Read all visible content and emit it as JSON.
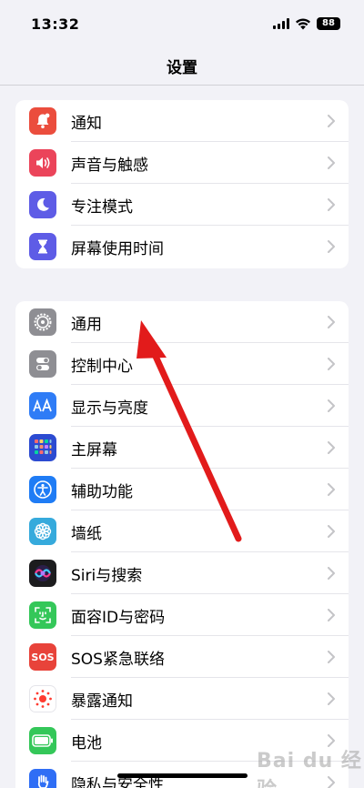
{
  "status_bar": {
    "time": "13:32",
    "battery": "88"
  },
  "nav": {
    "title": "设置"
  },
  "group1": [
    {
      "label": "通知",
      "icon": "bell-icon",
      "color": "#eb4d3d"
    },
    {
      "label": "声音与触感",
      "icon": "speaker-icon",
      "color": "#eb445a"
    },
    {
      "label": "专注模式",
      "icon": "moon-icon",
      "color": "#5e5ce6"
    },
    {
      "label": "屏幕使用时间",
      "icon": "hourglass-icon",
      "color": "#5e5ce6"
    }
  ],
  "group2": [
    {
      "label": "通用",
      "icon": "gear-icon",
      "color": "#8e8e93"
    },
    {
      "label": "控制中心",
      "icon": "toggles-icon",
      "color": "#8e8e93"
    },
    {
      "label": "显示与亮度",
      "icon": "text-size-icon",
      "color": "#2f7cf6"
    },
    {
      "label": "主屏幕",
      "icon": "home-grid-icon",
      "color": "#2c4bd1"
    },
    {
      "label": "辅助功能",
      "icon": "accessibility-icon",
      "color": "#1f7cf5"
    },
    {
      "label": "墙纸",
      "icon": "flower-icon",
      "color": "#36aadc"
    },
    {
      "label": "Siri与搜索",
      "icon": "siri-icon",
      "color": "#1c1c1e"
    },
    {
      "label": "面容ID与密码",
      "icon": "faceid-icon",
      "color": "#34c759"
    },
    {
      "label": "SOS紧急联络",
      "icon": "sos-icon",
      "color": "#e8433a"
    },
    {
      "label": "暴露通知",
      "icon": "exposure-icon",
      "color": "#ffffff"
    },
    {
      "label": "电池",
      "icon": "battery-icon",
      "color": "#34c759"
    },
    {
      "label": "隐私与安全性",
      "icon": "hand-icon",
      "color": "#2f6ef5"
    }
  ],
  "watermark": "Bai du 经验"
}
